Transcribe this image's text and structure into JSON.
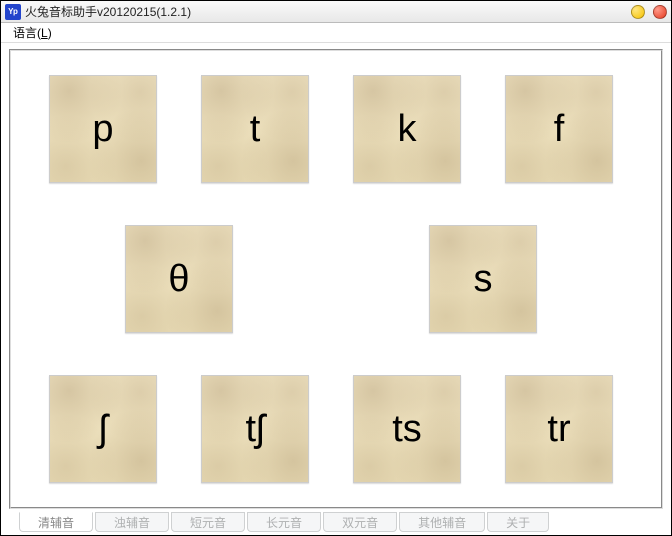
{
  "window": {
    "title": "火兔音标助手v20120215(1.2.1)",
    "icon_label": "Yp"
  },
  "menubar": {
    "language": {
      "label": "语言",
      "accel": "L"
    }
  },
  "cards": {
    "row1": [
      {
        "symbol": "p"
      },
      {
        "symbol": "t"
      },
      {
        "symbol": "k"
      },
      {
        "symbol": "f"
      }
    ],
    "row2": [
      {
        "symbol": "θ"
      },
      {
        "symbol": "s"
      }
    ],
    "row3": [
      {
        "symbol": "ʃ"
      },
      {
        "symbol": "tʃ"
      },
      {
        "symbol": "ts"
      },
      {
        "symbol": "tr"
      }
    ]
  },
  "tabs": [
    {
      "label": "清辅音",
      "active": true
    },
    {
      "label": "浊辅音",
      "active": false
    },
    {
      "label": "短元音",
      "active": false
    },
    {
      "label": "长元音",
      "active": false
    },
    {
      "label": "双元音",
      "active": false
    },
    {
      "label": "其他辅音",
      "active": false
    },
    {
      "label": "关于",
      "active": false
    }
  ]
}
